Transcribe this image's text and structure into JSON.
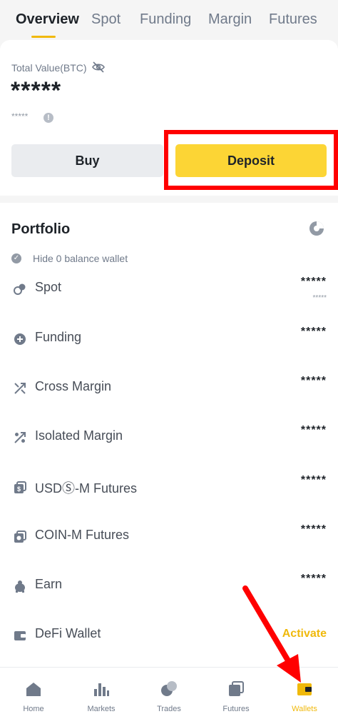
{
  "tabs": [
    "Overview",
    "Spot",
    "Funding",
    "Margin",
    "Futures"
  ],
  "summary": {
    "total_value_label": "Total Value(BTC)",
    "total_value": "*****",
    "total_value_fiat": "*****",
    "buy_label": "Buy",
    "deposit_label": "Deposit"
  },
  "portfolio": {
    "title": "Portfolio",
    "hide_zero_label": "Hide 0 balance wallet",
    "wallets": [
      {
        "name": "Spot",
        "value": "*****",
        "sub_value": "*****",
        "icon": "spot-icon"
      },
      {
        "name": "Funding",
        "value": "*****",
        "icon": "funding-icon"
      },
      {
        "name": "Cross Margin",
        "value": "*****",
        "icon": "cross-margin-icon"
      },
      {
        "name": "Isolated Margin",
        "value": "*****",
        "icon": "isolated-margin-icon"
      },
      {
        "name": "USDⓈ-M Futures",
        "value": "*****",
        "icon": "usdm-futures-icon"
      },
      {
        "name": "COIN-M Futures",
        "value": "*****",
        "icon": "coinm-futures-icon"
      },
      {
        "name": "Earn",
        "value": "*****",
        "icon": "earn-icon"
      },
      {
        "name": "DeFi Wallet",
        "action": "Activate",
        "icon": "defi-wallet-icon"
      }
    ]
  },
  "bottom_nav": [
    {
      "label": "Home",
      "icon": "home-icon"
    },
    {
      "label": "Markets",
      "icon": "markets-icon"
    },
    {
      "label": "Trades",
      "icon": "trades-icon"
    },
    {
      "label": "Futures",
      "icon": "futures-icon"
    },
    {
      "label": "Wallets",
      "icon": "wallets-icon",
      "active": true
    }
  ],
  "colors": {
    "accent": "#f0b90b",
    "deposit_button": "#fcd535",
    "annotation_red": "#ff0000"
  }
}
